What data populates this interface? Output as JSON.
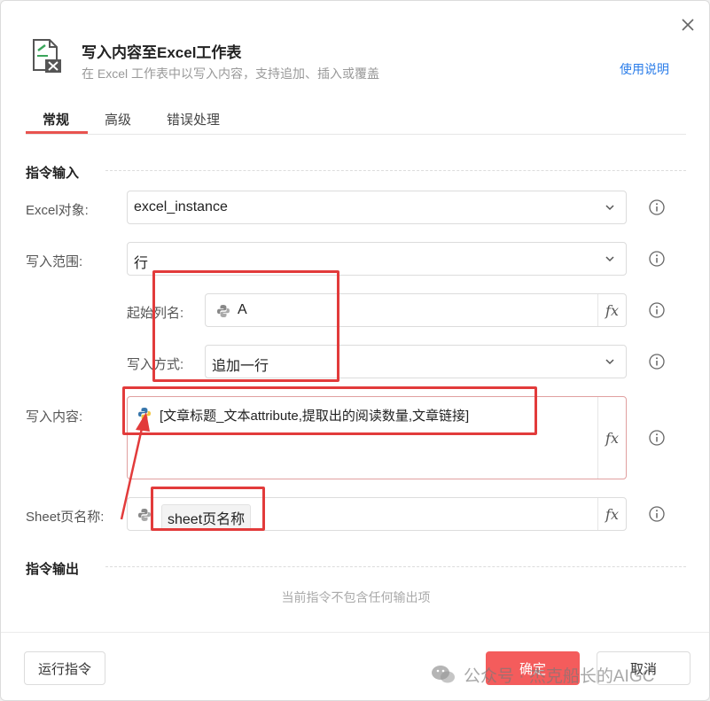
{
  "dialog": {
    "title": "写入内容至Excel工作表",
    "subtitle": "在 Excel 工作表中以写入内容，支持追加、插入或覆盖",
    "help_link": "使用说明",
    "close_label": "×"
  },
  "tabs": [
    {
      "label": "常规",
      "active": true
    },
    {
      "label": "高级",
      "active": false
    },
    {
      "label": "错误处理",
      "active": false
    }
  ],
  "sections": {
    "input": "指令输入",
    "output": "指令输出",
    "empty_output": "当前指令不包含任何输出项"
  },
  "fields": {
    "excel_object": {
      "label": "Excel对象:",
      "value": "excel_instance"
    },
    "write_range": {
      "label": "写入范围:",
      "value": "行"
    },
    "start_column": {
      "label": "起始列名:",
      "value": "A"
    },
    "write_mode": {
      "label": "写入方式:",
      "value": "追加一行"
    },
    "write_content": {
      "label": "写入内容:",
      "value": "[文章标题_文本attribute,提取出的阅读数量,文章链接]"
    },
    "sheet_name": {
      "label": "Sheet页名称:",
      "value": "sheet页名称"
    }
  },
  "fx_label": "fx",
  "buttons": {
    "run": "运行指令",
    "ok": "确定",
    "cancel": "取消"
  },
  "watermark": {
    "text": "公众号 · 杰克船长的AIGC"
  },
  "colors": {
    "accent": "#e8534f",
    "primary_button": "#f45c5c",
    "link": "#2b7de9",
    "annotation": "#e23b3b"
  }
}
